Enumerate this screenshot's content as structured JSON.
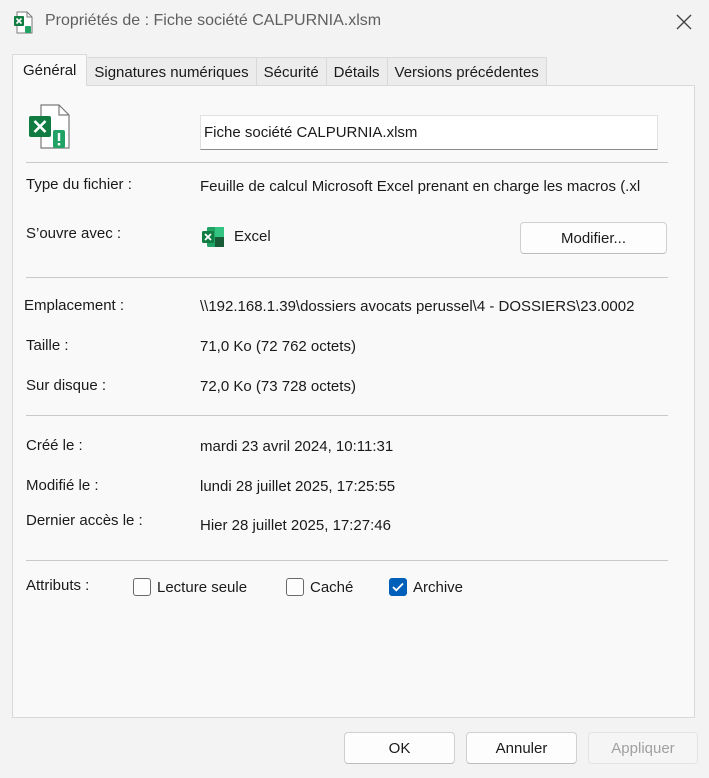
{
  "window": {
    "title": "Propriétés de : Fiche société CALPURNIA.xlsm",
    "close_icon": "close-icon"
  },
  "tabs": [
    {
      "label": "Général",
      "active": true
    },
    {
      "label": "Signatures numériques",
      "active": false
    },
    {
      "label": "Sécurité",
      "active": false
    },
    {
      "label": "Détails",
      "active": false
    },
    {
      "label": "Versions précédentes",
      "active": false
    }
  ],
  "general": {
    "file_icon": "excel-file-warning-icon",
    "file_name": "Fiche société CALPURNIA.xlsm",
    "type_label": "Type du fichier :",
    "type_value": "Feuille de calcul Microsoft Excel prenant en charge les macros (.xl",
    "opens_with_label": "S’ouvre avec :",
    "opens_with_app": "Excel",
    "opens_with_icon": "excel-icon",
    "change_button": "Modifier...",
    "location_label": "Emplacement :",
    "location_value": "\\\\192.168.1.39\\dossiers avocats perussel\\4 - DOSSIERS\\23.0002",
    "size_label": "Taille :",
    "size_value": "71,0 Ko (72 762 octets)",
    "size_on_disk_label": "Sur disque :",
    "size_on_disk_value": "72,0 Ko (73 728 octets)",
    "created_label": "Créé le :",
    "created_value": "mardi 23 avril 2024, 10:11:31",
    "modified_label": "Modifié le :",
    "modified_value": "lundi 28 juillet 2025, 17:25:55",
    "accessed_label": "Dernier accès le :",
    "accessed_value": "Hier 28 juillet 2025, 17:27:46",
    "attributes_label": "Attributs :",
    "attributes": [
      {
        "label": "Lecture seule",
        "checked": false
      },
      {
        "label": "Caché",
        "checked": false
      },
      {
        "label": "Archive",
        "checked": true
      }
    ]
  },
  "footer": {
    "ok": "OK",
    "cancel": "Annuler",
    "apply": "Appliquer",
    "apply_enabled": false
  },
  "colors": {
    "accent": "#005fb8",
    "excel_green": "#107c41",
    "warning_green": "#21a366"
  }
}
